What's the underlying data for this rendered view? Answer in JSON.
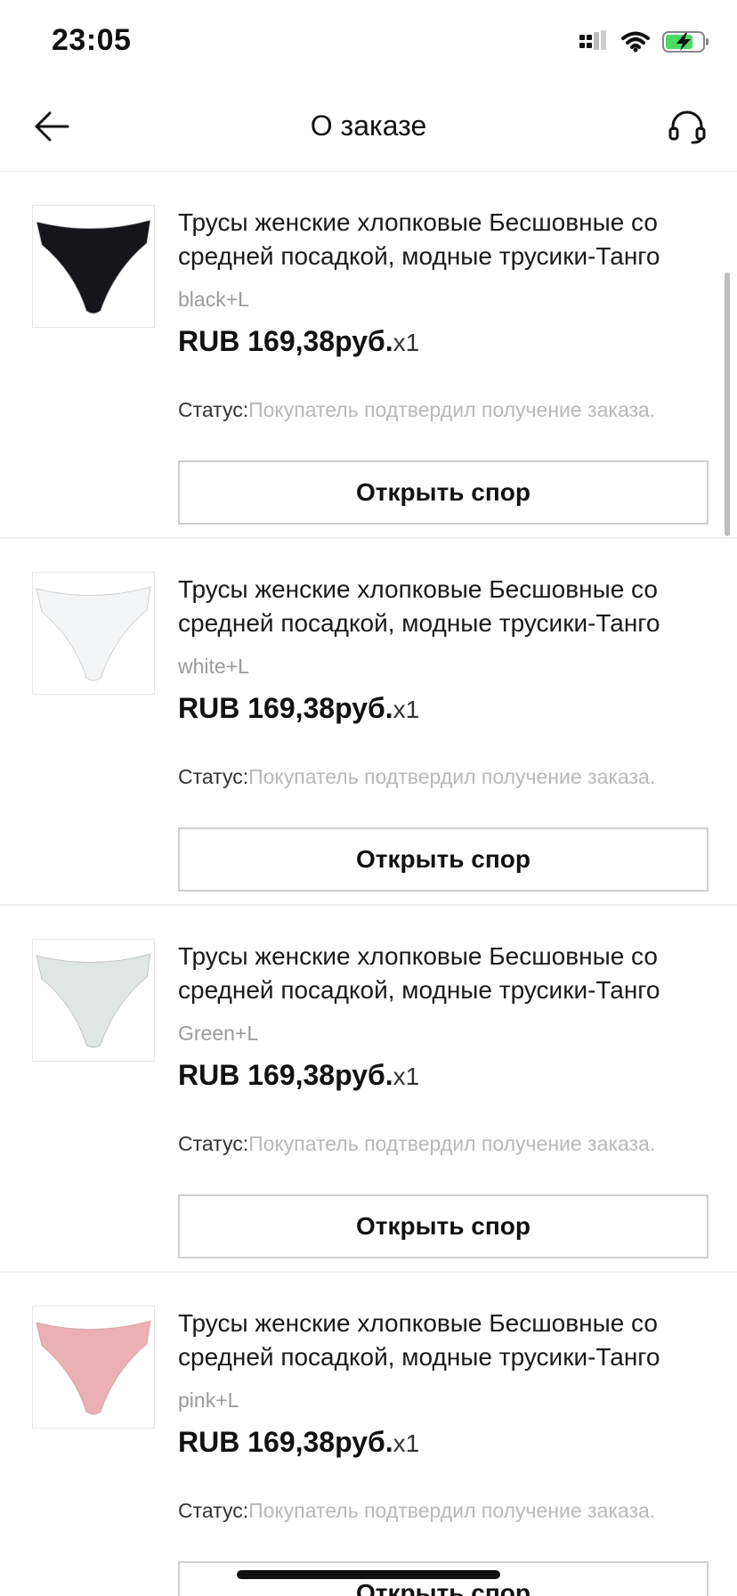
{
  "status_bar": {
    "time": "23:05",
    "icons": [
      "signal-icon",
      "wifi-icon",
      "battery-charging-icon"
    ]
  },
  "header": {
    "title": "О заказе",
    "back_icon": "back-arrow-icon",
    "support_icon": "headset-icon"
  },
  "items": [
    {
      "title": "Трусы женские хлопковые Бесшовные со средней посадкой, модные трусики-Танго",
      "variant": "black+L",
      "price": "RUB 169,38руб.",
      "qty": "x1",
      "status_label": "Статус:",
      "status_value": "Покупатель подтвердил получение заказа.",
      "button": "Открыть спор",
      "color": "#15151a"
    },
    {
      "title": "Трусы женские хлопковые Бесшовные со средней посадкой, модные трусики-Танго",
      "variant": "white+L",
      "price": "RUB 169,38руб.",
      "qty": "x1",
      "status_label": "Статус:",
      "status_value": "Покупатель подтвердил получение заказа.",
      "button": "Открыть спор",
      "color": "#f4f5f6"
    },
    {
      "title": "Трусы женские хлопковые Бесшовные со средней посадкой, модные трусики-Танго",
      "variant": "Green+L",
      "price": "RUB 169,38руб.",
      "qty": "x1",
      "status_label": "Статус:",
      "status_value": "Покупатель подтвердил получение заказа.",
      "button": "Открыть спор",
      "color": "#dfe6e3"
    },
    {
      "title": "Трусы женские хлопковые Бесшовные со средней посадкой, модные трусики-Танго",
      "variant": "pink+L",
      "price": "RUB 169,38руб.",
      "qty": "x1",
      "status_label": "Статус:",
      "status_value": "Покупатель подтвердил получение заказа.",
      "button": "Открыть спор",
      "color": "#eab0b3"
    }
  ]
}
